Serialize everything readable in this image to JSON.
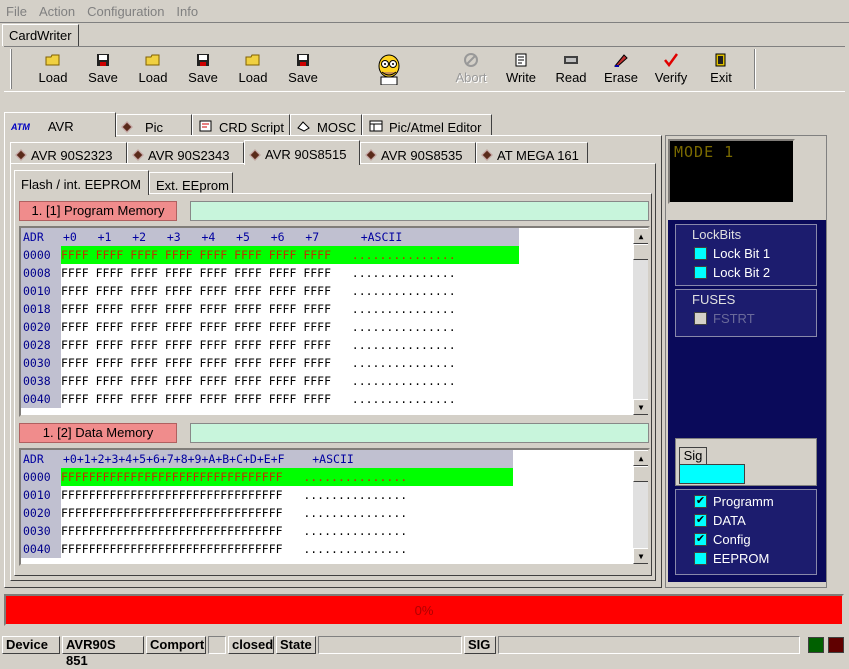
{
  "menu": [
    "File",
    "Action",
    "Configuration",
    "Info"
  ],
  "app_tab": "CardWriter",
  "toolbar": {
    "group1": [
      {
        "label": "Load",
        "icon": "folder-icon"
      },
      {
        "label": "Save",
        "icon": "save-icon"
      },
      {
        "label": "Load",
        "icon": "folder-icon"
      },
      {
        "label": "Save",
        "icon": "save-icon"
      },
      {
        "label": "Load",
        "icon": "folder-icon"
      },
      {
        "label": "Save",
        "icon": "save-icon"
      }
    ],
    "group2": [
      {
        "label": "Abort",
        "icon": "stop-icon",
        "disabled": true
      },
      {
        "label": "Write",
        "icon": "write-icon"
      },
      {
        "label": "Read",
        "icon": "read-icon"
      },
      {
        "label": "Erase",
        "icon": "erase-icon"
      },
      {
        "label": "Verify",
        "icon": "check-icon"
      },
      {
        "label": "Exit",
        "icon": "exit-icon"
      }
    ]
  },
  "main_tabs": [
    "AVR",
    "Pic",
    "CRD Script",
    "MOSC",
    "Pic/Atmel Editor"
  ],
  "device_tabs": [
    "AVR 90S2323",
    "AVR 90S2343",
    "AVR 90S8515",
    "AVR 90S8535",
    "AT MEGA 161"
  ],
  "mem_tabs": [
    "Flash / int. EEPROM",
    "Ext. EEprom"
  ],
  "program_memory": {
    "label": "1. [1] Program Memory",
    "header": "+0   +1   +2   +3   +4   +5   +6   +7      +ASCII",
    "adr_header": "ADR",
    "rows": [
      {
        "adr": "0000",
        "data": "FFFF FFFF FFFF FFFF FFFF FFFF FFFF FFFF   ..............."
      },
      {
        "adr": "0008",
        "data": "FFFF FFFF FFFF FFFF FFFF FFFF FFFF FFFF   ..............."
      },
      {
        "adr": "0010",
        "data": "FFFF FFFF FFFF FFFF FFFF FFFF FFFF FFFF   ..............."
      },
      {
        "adr": "0018",
        "data": "FFFF FFFF FFFF FFFF FFFF FFFF FFFF FFFF   ..............."
      },
      {
        "adr": "0020",
        "data": "FFFF FFFF FFFF FFFF FFFF FFFF FFFF FFFF   ..............."
      },
      {
        "adr": "0028",
        "data": "FFFF FFFF FFFF FFFF FFFF FFFF FFFF FFFF   ..............."
      },
      {
        "adr": "0030",
        "data": "FFFF FFFF FFFF FFFF FFFF FFFF FFFF FFFF   ..............."
      },
      {
        "adr": "0038",
        "data": "FFFF FFFF FFFF FFFF FFFF FFFF FFFF FFFF   ..............."
      },
      {
        "adr": "0040",
        "data": "FFFF FFFF FFFF FFFF FFFF FFFF FFFF FFFF   ..............."
      }
    ]
  },
  "data_memory": {
    "label": "1. [2] Data Memory",
    "header": "+0+1+2+3+4+5+6+7+8+9+A+B+C+D+E+F    +ASCII",
    "adr_header": "ADR",
    "rows": [
      {
        "adr": "0000",
        "data": "FFFFFFFFFFFFFFFFFFFFFFFFFFFFFFFF   ..............."
      },
      {
        "adr": "0010",
        "data": "FFFFFFFFFFFFFFFFFFFFFFFFFFFFFFFF   ..............."
      },
      {
        "adr": "0020",
        "data": "FFFFFFFFFFFFFFFFFFFFFFFFFFFFFFFF   ..............."
      },
      {
        "adr": "0030",
        "data": "FFFFFFFFFFFFFFFFFFFFFFFFFFFFFFFF   ..............."
      },
      {
        "adr": "0040",
        "data": "FFFFFFFFFFFFFFFFFFFFFFFFFFFFFFFF   ..............."
      }
    ]
  },
  "mode_display": "MODE 1",
  "lockbits": {
    "title": "LockBits",
    "items": [
      "Lock Bit 1",
      "Lock Bit 2"
    ]
  },
  "fuses": {
    "title": "FUSES",
    "items": [
      "FSTRT"
    ]
  },
  "sig": {
    "label": "Sig",
    "value": ""
  },
  "options": [
    {
      "label": "Programm",
      "checked": true
    },
    {
      "label": "DATA",
      "checked": true
    },
    {
      "label": "Config",
      "checked": true
    },
    {
      "label": "EEPROM",
      "checked": false
    }
  ],
  "progress": {
    "text": "0%",
    "value": 0,
    "color": "#ff0000"
  },
  "status": {
    "device_label": "Device",
    "device_value": "AVR90S 851",
    "comport_label": "Comport",
    "comport_value": "closed",
    "state_label": "State",
    "state_value": "",
    "sig_label": "SIG",
    "sig_value": ""
  }
}
